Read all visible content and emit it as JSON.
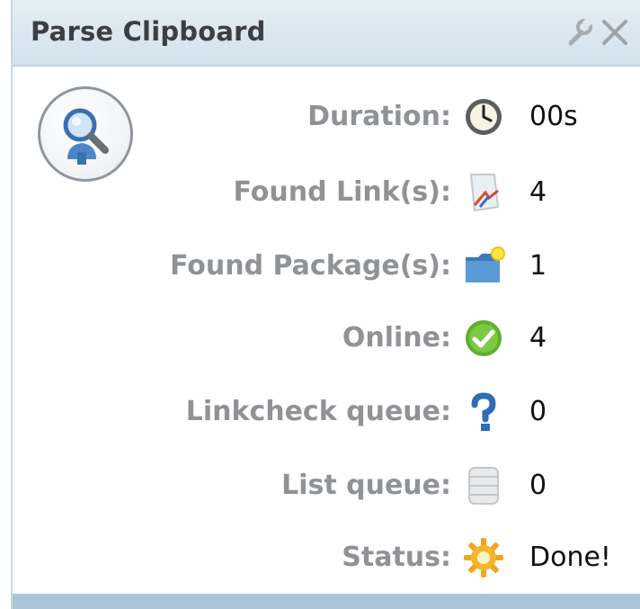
{
  "panel": {
    "title": "Parse Clipboard",
    "accent_color": "#a9c6d8",
    "header_color": "#dde8f0",
    "label_color": "#909396"
  },
  "toolbar": {
    "settings_icon": "wrench-icon",
    "close_icon": "close-icon"
  },
  "main_icon": "search-user-icon",
  "rows": [
    {
      "label": "Duration:",
      "value": "00s",
      "icon": "clock-icon"
    },
    {
      "label": "Found Link(s):",
      "value": "4",
      "icon": "links-icon"
    },
    {
      "label": "Found Package(s):",
      "value": "1",
      "icon": "folder-icon"
    },
    {
      "label": "Online:",
      "value": "4",
      "icon": "check-icon"
    },
    {
      "label": "Linkcheck queue:",
      "value": "0",
      "icon": "question-icon"
    },
    {
      "label": "List queue:",
      "value": "0",
      "icon": "database-icon"
    },
    {
      "label": "Status:",
      "value": "Done!",
      "icon": "gear-icon"
    }
  ]
}
